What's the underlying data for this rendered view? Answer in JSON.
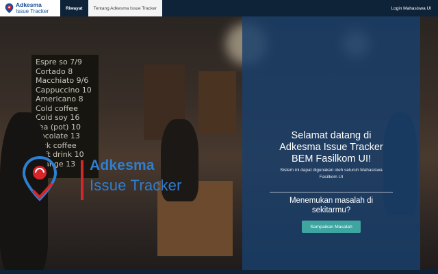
{
  "navbar": {
    "brand_line1": "Adkesma",
    "brand_line2": "Issue Tracker",
    "links": [
      "Riwayat",
      "Tentang Adkesma Issue Tracker"
    ],
    "login": "Login Mahasiswa UI"
  },
  "hero": {
    "welcome_lines": [
      "Selamat datang di",
      "Adkesma Issue Tracker",
      "BEM Fasilkom UI!"
    ],
    "subtitle_lines": [
      "Sistem ini dapat digunakan oleh seluruh Mahasiswa",
      "Fasilkom UI"
    ],
    "question_lines": [
      "Menemukan masalah di",
      "sekitarmu?"
    ],
    "cta_label": "Sampaikan Masalah"
  },
  "logo": {
    "line1": "Adkesma",
    "line2": "Issue Tracker"
  },
  "background_menu": [
    "Espre so 7/9",
    "Cortado 8",
    "Macchiato 9/6",
    "Cappuccino 10",
    "Americano 8",
    "Cold coffee",
    "Cold soy 16",
    "Tea (pot) 10",
    "hocolate 13",
    "lack coffee",
    "Soft drink 10",
    "Orange 13"
  ],
  "colors": {
    "navbar": "#0e2238",
    "panel": "#18406c",
    "cta": "#3ea5a0",
    "brand_blue": "#2f7fd0",
    "brand_red": "#d7262a"
  }
}
